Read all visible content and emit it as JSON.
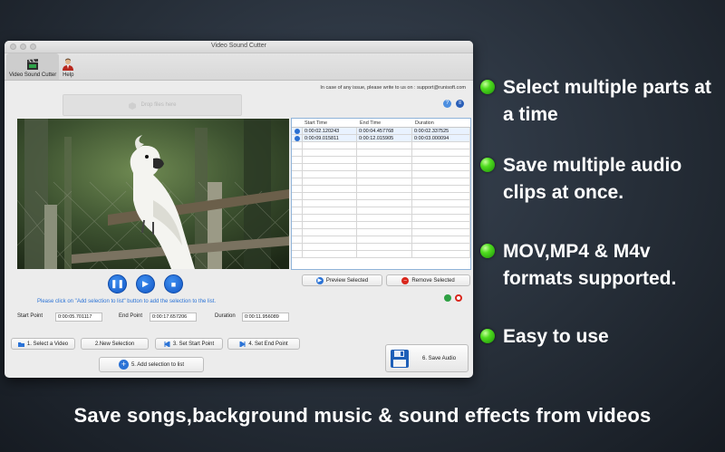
{
  "window": {
    "title": "Video Sound Cutter",
    "support_text": "In case of any issue, please write to us on : support@runisoft.com"
  },
  "toolbar": {
    "items": [
      {
        "label": "Video Sound Cutter",
        "icon": "clapperboard-icon"
      },
      {
        "label": "Help",
        "icon": "person-help-icon"
      }
    ]
  },
  "drop_area": {
    "label": "Drop files here"
  },
  "table": {
    "headers": [
      "Start Time",
      "End Time",
      "Duration"
    ],
    "rows": [
      [
        "0:00:02.120243",
        "0:00:04.457768",
        "0:00:02.337525"
      ],
      [
        "0:00:09.015811",
        "0:00:12.015905",
        "0:00:03.000094"
      ]
    ]
  },
  "actions": {
    "preview": "Preview Selected",
    "remove": "Remove Selected"
  },
  "hint": "Please click on \"Add selection to list\" button to add the selection to the list.",
  "points": {
    "start_label": "Start Point",
    "start_value": "0:00:05.701117",
    "end_label": "End Point",
    "end_value": "0:00:17.657206",
    "duration_label": "Duration",
    "duration_value": "0:00:11.956089"
  },
  "steps": {
    "select_video": "1. Select a Video",
    "new_selection": "2.New Selection",
    "set_start": "3. Set Start Point",
    "set_end": "4. Set End Point",
    "add_selection": "5. Add selection to list",
    "save_audio": "6. Save Audio"
  },
  "promo": {
    "bullets": [
      "Select multiple parts at a time",
      "Save multiple audio clips at once.",
      "MOV,MP4 & M4v formats supported.",
      "Easy to use"
    ],
    "footer": "Save songs,background music & sound effects from videos"
  },
  "colors": {
    "accent_blue": "#2b73d6",
    "bullet_green": "#4fdc1f",
    "remove_red": "#d9261c"
  }
}
